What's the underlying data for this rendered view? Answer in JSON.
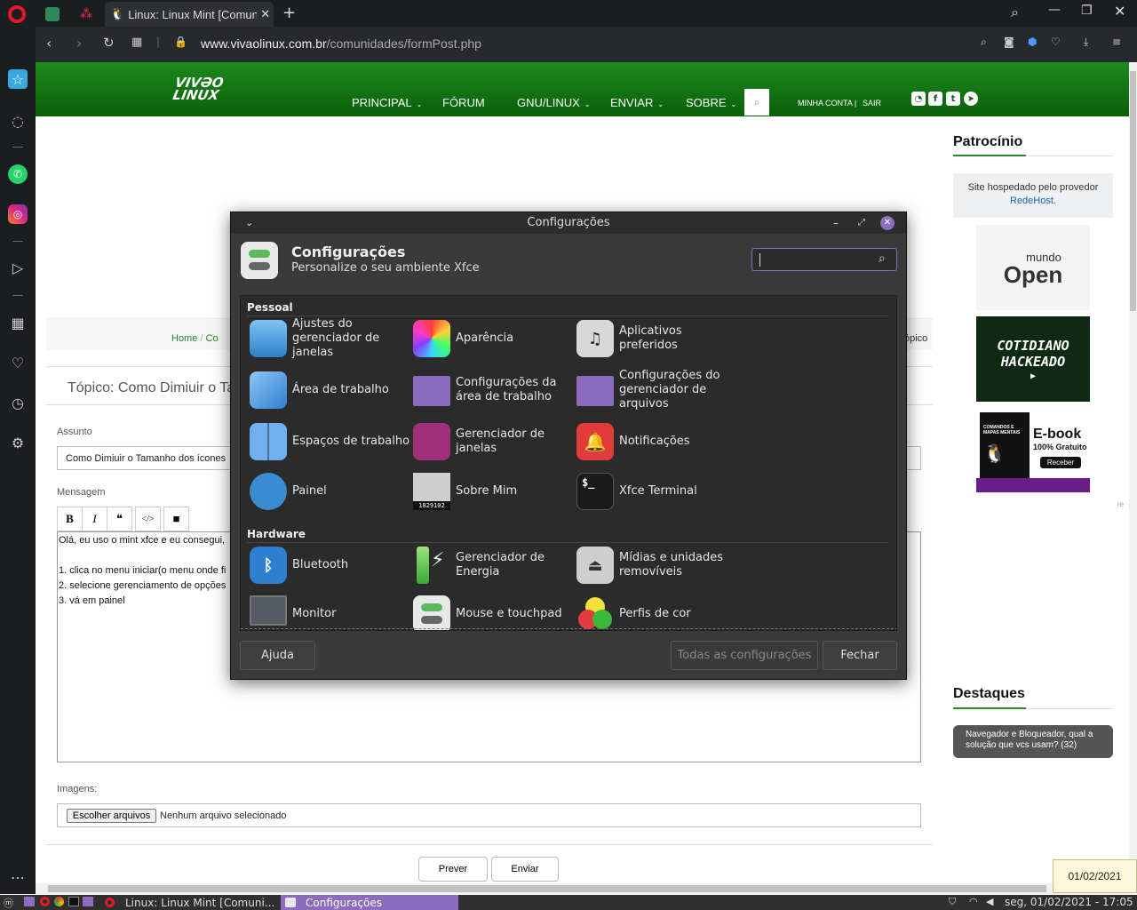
{
  "browser": {
    "tabs": [
      {
        "label": "Linux: Linux Mint [Comunidade"
      }
    ],
    "url_domain": "www.vivaolinux.com.br",
    "url_path": "/comunidades/formPost.php"
  },
  "site": {
    "logo_line1": "VIVƏO",
    "logo_line2": "LINUX",
    "nav": {
      "principal": "PRINCIPAL",
      "forum": "FÓRUM",
      "gnu_linux": "GNU/LINUX",
      "enviar": "ENVIAR",
      "sobre": "SOBRE",
      "minha_conta": "MINHA CONTA",
      "separator": "|",
      "sair": "SAIR"
    },
    "breadcrumb": {
      "home": "Home",
      "sep": "/",
      "partial": "Co",
      "right_partial": "ópico"
    },
    "topic_title": "Tópico: Como Dimiuir o Ta",
    "form": {
      "assunto_label": "Assunto",
      "assunto_value": "Como Dimiuir o Tamanho dos ícones",
      "mensagem_label": "Mensagem",
      "toolbar": {
        "bold": "B",
        "italic": "I",
        "quote": "❝",
        "code": "</>",
        "video": "■"
      },
      "message_lines": [
        "Olá, eu uso o mint xfce e eu consegui,",
        "",
        "1. clica no menu iniciar(o menu onde fi",
        "2. selecione gerenciamento de opções",
        "3. vá em painel"
      ],
      "imagens_label": "Imagens:",
      "file_button": "Escolher arquivos",
      "file_status": "Nenhum arquivo selecionado",
      "preview_button": "Prever",
      "send_button": "Enviar"
    },
    "sidebar": {
      "patrocinio_title": "Patrocínio",
      "hosted_text": "Site hospedado pelo provedor",
      "hosted_link": "RedeHost.",
      "ad1_line1": "mundo",
      "ad1_line2": "Open",
      "ad2_line1": "COTIDIANO",
      "ad2_line2": "HACKEADO",
      "ad3_small": "COMANDOS E MAPAS MENTAIS",
      "ad3_title": "E-book",
      "ad3_sub": "100% Gratuito",
      "ad3_btn": "Receber",
      "edge_text": "re",
      "destaques_title": "Destaques",
      "destaque_item": "Navegador e Bloqueador, qual a solução que vcs usam? (32)"
    }
  },
  "dialog": {
    "window_title": "Configurações",
    "header_title": "Configurações",
    "header_subtitle": "Personalize o seu ambiente Xfce",
    "search_value": "",
    "sections": [
      {
        "title": "Pessoal",
        "items": [
          {
            "label": "Ajustes do gerenciador de janelas",
            "icon": "wand-icon"
          },
          {
            "label": "Aparência",
            "icon": "brush-icon"
          },
          {
            "label": "Aplicativos preferidos",
            "icon": "music-app-icon"
          },
          {
            "label": "Área de trabalho",
            "icon": "desktop-icon"
          },
          {
            "label": "Configurações da área de trabalho",
            "icon": "folder-icon"
          },
          {
            "label": "Configurações do gerenciador de arquivos",
            "icon": "folder-icon"
          },
          {
            "label": "Espaços de trabalho",
            "icon": "workspaces-icon"
          },
          {
            "label": "Gerenciador de janelas",
            "icon": "windows-icon"
          },
          {
            "label": "Notificações",
            "icon": "bell-icon"
          },
          {
            "label": "Painel",
            "icon": "panel-icon"
          },
          {
            "label": "Sobre Mim",
            "icon": "person-icon",
            "badge": "1829102"
          },
          {
            "label": "Xfce Terminal",
            "icon": "terminal-icon",
            "glyph": "$_"
          }
        ]
      },
      {
        "title": "Hardware",
        "items": [
          {
            "label": "Bluetooth",
            "icon": "bluetooth-icon"
          },
          {
            "label": "Gerenciador de Energia",
            "icon": "battery-icon"
          },
          {
            "label": "Mídias e unidades removíveis",
            "icon": "eject-icon"
          },
          {
            "label": "Monitor",
            "icon": "monitor-icon"
          },
          {
            "label": "Mouse e touchpad",
            "icon": "toggle-icon"
          },
          {
            "label": "Perfis de cor",
            "icon": "color-icon"
          }
        ]
      }
    ],
    "help_button": "Ajuda",
    "all_settings_button": "Todas as configurações",
    "close_button": "Fechar"
  },
  "tooltip_date": "01/02/2021",
  "taskbar": {
    "task1": "Linux: Linux Mint [Comuni...",
    "task2": "Configurações",
    "clock": "seg, 01/02/2021 - 17:05"
  },
  "colors": {
    "site_green": "#0a5f0a",
    "accent_purple": "#8d6bbf",
    "dialog_bg": "#3a3a3a"
  }
}
